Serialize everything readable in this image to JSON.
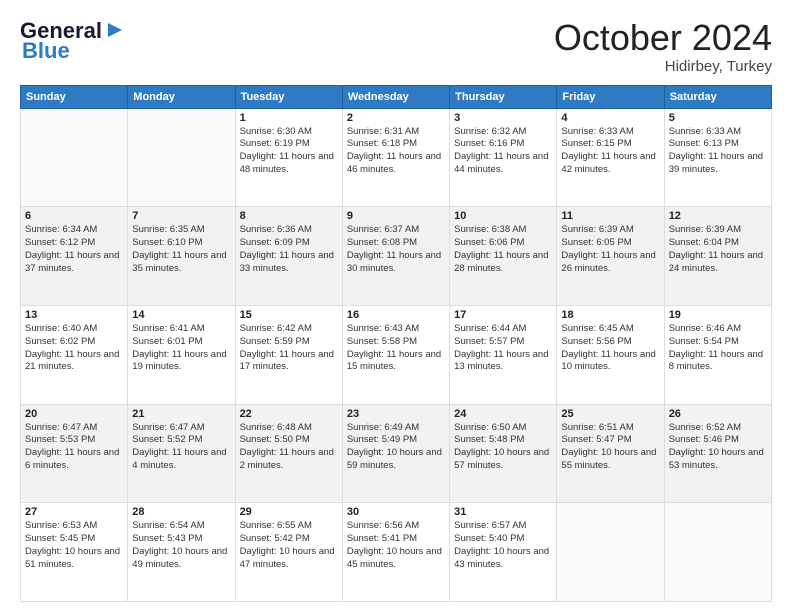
{
  "header": {
    "logo_line1": "General",
    "logo_line2": "Blue",
    "month": "October 2024",
    "location": "Hidirbey, Turkey"
  },
  "weekdays": [
    "Sunday",
    "Monday",
    "Tuesday",
    "Wednesday",
    "Thursday",
    "Friday",
    "Saturday"
  ],
  "weeks": [
    [
      {
        "day": "",
        "text": ""
      },
      {
        "day": "",
        "text": ""
      },
      {
        "day": "1",
        "text": "Sunrise: 6:30 AM\nSunset: 6:19 PM\nDaylight: 11 hours and 48 minutes."
      },
      {
        "day": "2",
        "text": "Sunrise: 6:31 AM\nSunset: 6:18 PM\nDaylight: 11 hours and 46 minutes."
      },
      {
        "day": "3",
        "text": "Sunrise: 6:32 AM\nSunset: 6:16 PM\nDaylight: 11 hours and 44 minutes."
      },
      {
        "day": "4",
        "text": "Sunrise: 6:33 AM\nSunset: 6:15 PM\nDaylight: 11 hours and 42 minutes."
      },
      {
        "day": "5",
        "text": "Sunrise: 6:33 AM\nSunset: 6:13 PM\nDaylight: 11 hours and 39 minutes."
      }
    ],
    [
      {
        "day": "6",
        "text": "Sunrise: 6:34 AM\nSunset: 6:12 PM\nDaylight: 11 hours and 37 minutes."
      },
      {
        "day": "7",
        "text": "Sunrise: 6:35 AM\nSunset: 6:10 PM\nDaylight: 11 hours and 35 minutes."
      },
      {
        "day": "8",
        "text": "Sunrise: 6:36 AM\nSunset: 6:09 PM\nDaylight: 11 hours and 33 minutes."
      },
      {
        "day": "9",
        "text": "Sunrise: 6:37 AM\nSunset: 6:08 PM\nDaylight: 11 hours and 30 minutes."
      },
      {
        "day": "10",
        "text": "Sunrise: 6:38 AM\nSunset: 6:06 PM\nDaylight: 11 hours and 28 minutes."
      },
      {
        "day": "11",
        "text": "Sunrise: 6:39 AM\nSunset: 6:05 PM\nDaylight: 11 hours and 26 minutes."
      },
      {
        "day": "12",
        "text": "Sunrise: 6:39 AM\nSunset: 6:04 PM\nDaylight: 11 hours and 24 minutes."
      }
    ],
    [
      {
        "day": "13",
        "text": "Sunrise: 6:40 AM\nSunset: 6:02 PM\nDaylight: 11 hours and 21 minutes."
      },
      {
        "day": "14",
        "text": "Sunrise: 6:41 AM\nSunset: 6:01 PM\nDaylight: 11 hours and 19 minutes."
      },
      {
        "day": "15",
        "text": "Sunrise: 6:42 AM\nSunset: 5:59 PM\nDaylight: 11 hours and 17 minutes."
      },
      {
        "day": "16",
        "text": "Sunrise: 6:43 AM\nSunset: 5:58 PM\nDaylight: 11 hours and 15 minutes."
      },
      {
        "day": "17",
        "text": "Sunrise: 6:44 AM\nSunset: 5:57 PM\nDaylight: 11 hours and 13 minutes."
      },
      {
        "day": "18",
        "text": "Sunrise: 6:45 AM\nSunset: 5:56 PM\nDaylight: 11 hours and 10 minutes."
      },
      {
        "day": "19",
        "text": "Sunrise: 6:46 AM\nSunset: 5:54 PM\nDaylight: 11 hours and 8 minutes."
      }
    ],
    [
      {
        "day": "20",
        "text": "Sunrise: 6:47 AM\nSunset: 5:53 PM\nDaylight: 11 hours and 6 minutes."
      },
      {
        "day": "21",
        "text": "Sunrise: 6:47 AM\nSunset: 5:52 PM\nDaylight: 11 hours and 4 minutes."
      },
      {
        "day": "22",
        "text": "Sunrise: 6:48 AM\nSunset: 5:50 PM\nDaylight: 11 hours and 2 minutes."
      },
      {
        "day": "23",
        "text": "Sunrise: 6:49 AM\nSunset: 5:49 PM\nDaylight: 10 hours and 59 minutes."
      },
      {
        "day": "24",
        "text": "Sunrise: 6:50 AM\nSunset: 5:48 PM\nDaylight: 10 hours and 57 minutes."
      },
      {
        "day": "25",
        "text": "Sunrise: 6:51 AM\nSunset: 5:47 PM\nDaylight: 10 hours and 55 minutes."
      },
      {
        "day": "26",
        "text": "Sunrise: 6:52 AM\nSunset: 5:46 PM\nDaylight: 10 hours and 53 minutes."
      }
    ],
    [
      {
        "day": "27",
        "text": "Sunrise: 6:53 AM\nSunset: 5:45 PM\nDaylight: 10 hours and 51 minutes."
      },
      {
        "day": "28",
        "text": "Sunrise: 6:54 AM\nSunset: 5:43 PM\nDaylight: 10 hours and 49 minutes."
      },
      {
        "day": "29",
        "text": "Sunrise: 6:55 AM\nSunset: 5:42 PM\nDaylight: 10 hours and 47 minutes."
      },
      {
        "day": "30",
        "text": "Sunrise: 6:56 AM\nSunset: 5:41 PM\nDaylight: 10 hours and 45 minutes."
      },
      {
        "day": "31",
        "text": "Sunrise: 6:57 AM\nSunset: 5:40 PM\nDaylight: 10 hours and 43 minutes."
      },
      {
        "day": "",
        "text": ""
      },
      {
        "day": "",
        "text": ""
      }
    ]
  ]
}
